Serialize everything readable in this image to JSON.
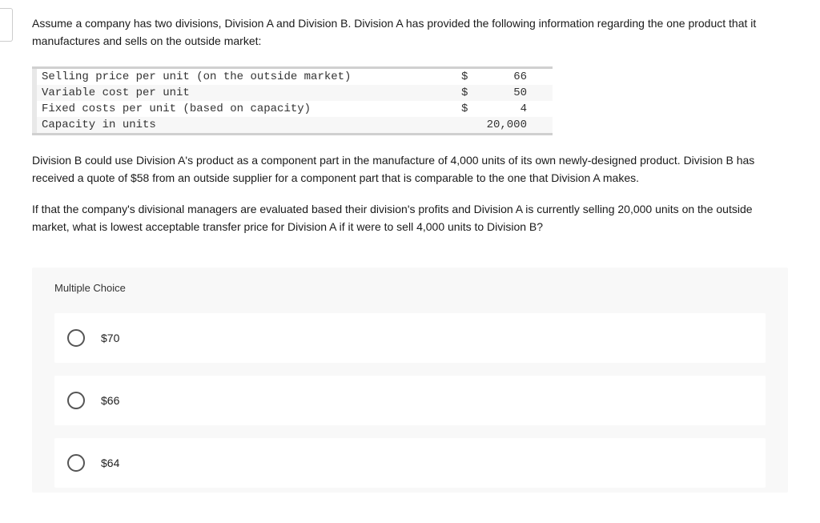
{
  "intro": "Assume a company has two divisions, Division A and Division B. Division A has provided the following information regarding the one product that it manufactures and sells on the outside market:",
  "table": {
    "rows": [
      {
        "label": "Selling price per unit (on the outside market)",
        "sym": "$",
        "val": "66"
      },
      {
        "label": "Variable cost per unit",
        "sym": "$",
        "val": "50"
      },
      {
        "label": "Fixed costs per unit (based on capacity)",
        "sym": "$",
        "val": "4"
      },
      {
        "label": "Capacity in units",
        "sym": "",
        "val": "20,000"
      }
    ]
  },
  "para1": "Division B could use Division A's product as a component part in the manufacture of 4,000 units of its own newly-designed product. Division B has received a quote of $58 from an outside supplier for a component part that is comparable to the one that Division A makes.",
  "para2": "If that the company's divisional managers are evaluated based their division's profits and Division A is currently selling 20,000 units on the outside market, what is lowest acceptable transfer price for Division A if it were to sell 4,000 units to Division B?",
  "mc_label": "Multiple Choice",
  "choices": [
    {
      "text": "$70"
    },
    {
      "text": "$66"
    },
    {
      "text": "$64"
    }
  ]
}
